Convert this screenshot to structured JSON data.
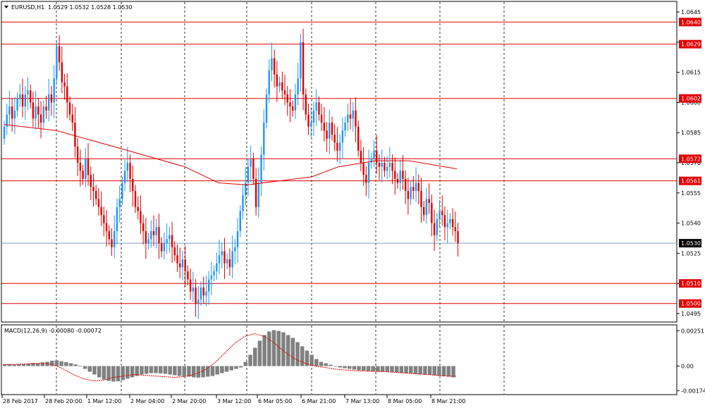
{
  "header": {
    "symbol": "EURUSD,H1",
    "ohlc": "1.0529 1.0532 1.0528 1.0530",
    "menu_icon": "triangle-down-icon"
  },
  "macd": {
    "label": "MACD(12,26,9) -0.00080 -0.00072"
  },
  "colors": {
    "bull": "#2196f3",
    "bear": "#e00000",
    "level": "#e00000",
    "price_line": "#7a9ec0",
    "signal": "#e00000",
    "hist": "#808080",
    "grid": "#000000"
  },
  "chart_data": [
    {
      "type": "candlestick",
      "title": "EURUSD,H1",
      "ylim": [
        1.049,
        1.065
      ],
      "y_ticks": [
        "1.0645",
        "1.0630",
        "1.0615",
        "1.0600",
        "1.0585",
        "1.0570",
        "1.0555",
        "1.0540",
        "1.0525",
        "1.0510",
        "1.0495"
      ],
      "x_tick_labels": [
        "28 Feb 2017",
        "28 Feb 20:00",
        "1 Mar 12:00",
        "2 Mar 04:00",
        "2 Mar 20:00",
        "3 Mar 12:00",
        "6 Mar 05:00",
        "6 Mar 21:00",
        "7 Mar 13:00",
        "8 Mar 05:00",
        "8 Mar 21:00"
      ],
      "horizontal_levels": [
        {
          "value": 1.064,
          "label": "1.0640"
        },
        {
          "value": 1.0629,
          "label": "1.0629"
        },
        {
          "value": 1.0602,
          "label": "1.0602"
        },
        {
          "value": 1.0572,
          "label": "1.0572"
        },
        {
          "value": 1.0561,
          "label": "1.0561"
        },
        {
          "value": 1.051,
          "label": "1.0510"
        },
        {
          "value": 1.05,
          "label": "1.0500"
        }
      ],
      "current_price": {
        "value": 1.053,
        "label": "1.0530"
      },
      "closes": [
        1.0588,
        1.0594,
        1.0598,
        1.0592,
        1.0596,
        1.0602,
        1.0604,
        1.0598,
        1.0604,
        1.0606,
        1.06,
        1.0592,
        1.0598,
        1.0594,
        1.059,
        1.0598,
        1.0596,
        1.0604,
        1.06,
        1.0612,
        1.0628,
        1.062,
        1.061,
        1.0608,
        1.06,
        1.0594,
        1.059,
        1.0578,
        1.057,
        1.0566,
        1.0562,
        1.0572,
        1.0564,
        1.0558,
        1.0556,
        1.0552,
        1.0548,
        1.0544,
        1.054,
        1.0536,
        1.0532,
        1.0528,
        1.0536,
        1.0548,
        1.0552,
        1.056,
        1.0566,
        1.057,
        1.0562,
        1.0556,
        1.0548,
        1.0546,
        1.054,
        1.0536,
        1.053,
        1.0532,
        1.0536,
        1.0534,
        1.0538,
        1.053,
        1.0526,
        1.053,
        1.0532,
        1.0534,
        1.0528,
        1.0524,
        1.052,
        1.0518,
        1.0522,
        1.0516,
        1.0512,
        1.0506,
        1.0508,
        1.05,
        1.0502,
        1.0508,
        1.0504,
        1.0506,
        1.0512,
        1.0514,
        1.0516,
        1.052,
        1.0524,
        1.0526,
        1.052,
        1.0522,
        1.0518,
        1.0526,
        1.0528,
        1.0536,
        1.0546,
        1.0554,
        1.056,
        1.0568,
        1.0572,
        1.0562,
        1.0548,
        1.056,
        1.0574,
        1.059,
        1.0604,
        1.0616,
        1.0622,
        1.0614,
        1.0608,
        1.061,
        1.0606,
        1.0604,
        1.06,
        1.0598,
        1.0596,
        1.0604,
        1.0612,
        1.063,
        1.0604,
        1.0594,
        1.0588,
        1.059,
        1.0596,
        1.06,
        1.0594,
        1.059,
        1.0586,
        1.0582,
        1.059,
        1.0584,
        1.058,
        1.0576,
        1.058,
        1.0586,
        1.059,
        1.0594,
        1.0592,
        1.0596,
        1.0588,
        1.0576,
        1.057,
        1.0564,
        1.056,
        1.057,
        1.0572,
        1.0576,
        1.057,
        1.0568,
        1.057,
        1.0566,
        1.0568,
        1.057,
        1.0566,
        1.0562,
        1.056,
        1.0566,
        1.0562,
        1.0556,
        1.0552,
        1.0558,
        1.0556,
        1.056,
        1.0556,
        1.0548,
        1.0544,
        1.0552,
        1.055,
        1.054,
        1.0534,
        1.0542,
        1.0546,
        1.0544,
        1.0538,
        1.054,
        1.0542,
        1.0538,
        1.0536,
        1.053
      ],
      "series": [
        {
          "name": "",
          "type": "moving-average",
          "values_at_x_ticks": [
            1.0589,
            1.0586,
            1.0577,
            1.0568,
            1.056,
            1.0559,
            1.0563,
            1.0568,
            1.0571,
            1.0571,
            1.0567
          ]
        }
      ]
    },
    {
      "type": "bar",
      "title": "MACD(12,26,9)",
      "ylim": [
        -0.0019,
        0.0027
      ],
      "y_ticks": [
        "0.00251",
        "0.00",
        "-0.00174"
      ],
      "histogram": [
        0.00012,
        0.00014,
        0.0001,
        0.00012,
        0.00014,
        0.00018,
        0.00022,
        0.0002,
        0.00026,
        0.0003,
        0.00038,
        0.0004,
        0.00034,
        0.00028,
        0.0002,
        0.00012,
        2e-05,
        -0.0002,
        -0.0004,
        -0.0006,
        -0.0008,
        -0.00095,
        -0.00105,
        -0.0011,
        -0.00108,
        -0.001,
        -0.0009,
        -0.0008,
        -0.0007,
        -0.0006,
        -0.00055,
        -0.0005,
        -0.0005,
        -0.00052,
        -0.00055,
        -0.0006,
        -0.00065,
        -0.0007,
        -0.00072,
        -0.00075,
        -0.0008,
        -0.00082,
        -0.0008,
        -0.00075,
        -0.0007,
        -0.0006,
        -0.0005,
        -0.0004,
        -0.0003,
        -0.0002,
        -0.0001,
        0.0003,
        0.0008,
        0.0013,
        0.0018,
        0.0022,
        0.00245,
        0.00255,
        0.0025,
        0.0024,
        0.0022,
        0.002,
        0.0017,
        0.0014,
        0.0011,
        0.0008,
        0.0005,
        0.0003,
        0.0002,
        0.0001,
        0.0,
        -0.0001,
        -0.00015,
        -0.0002,
        -0.00025,
        -0.0003,
        -0.00032,
        -0.00035,
        -0.00038,
        -0.0004,
        -0.0004,
        -0.0004,
        -0.00042,
        -0.00045,
        -0.00048,
        -0.0005,
        -0.00052,
        -0.00055,
        -0.00058,
        -0.0006,
        -0.00062,
        -0.00065,
        -0.0007,
        -0.00072,
        -0.00075,
        -0.0008
      ],
      "series": [
        {
          "name": "",
          "type": "signal-line",
          "values": [
            0.0001,
            0.00012,
            0.00014,
            0.00018,
            0.0002,
            0.0001,
            -0.0002,
            -0.0006,
            -0.0009,
            -0.00105,
            -0.001,
            -0.0008,
            -0.0007,
            -0.0006,
            -0.00065,
            -0.0007,
            -0.00075,
            -0.0008,
            -0.00075,
            -0.0006,
            -0.0003,
            0.0002,
            0.0009,
            0.0016,
            0.0021,
            0.0023,
            0.0021,
            0.0016,
            0.001,
            0.0005,
            0.0002,
            0.0,
            -0.0001,
            -0.00022,
            -0.00028,
            -0.00033,
            -0.00036,
            -0.00038,
            -0.0004,
            -0.00045,
            -0.0005,
            -0.00055,
            -0.0006,
            -0.00065,
            -0.0007,
            -0.00072
          ]
        }
      ]
    }
  ]
}
